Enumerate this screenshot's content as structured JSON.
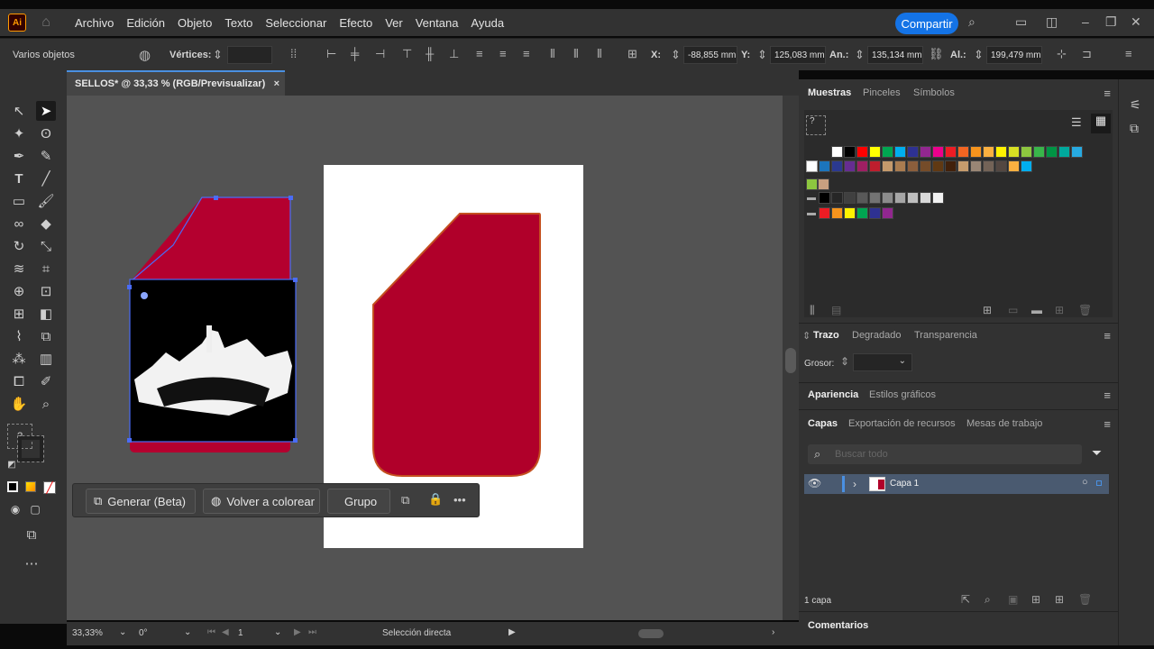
{
  "app": {
    "logo": "Ai",
    "home_icon": "home-icon"
  },
  "menu": [
    "Archivo",
    "Edición",
    "Objeto",
    "Texto",
    "Seleccionar",
    "Efecto",
    "Ver",
    "Ventana",
    "Ayuda"
  ],
  "share_label": "Compartir",
  "control": {
    "selection_label": "Varios objetos",
    "vertices_label": "Vértices:",
    "x_label": "X:",
    "x_value": "-88,855 mm",
    "y_label": "Y:",
    "y_value": "125,083 mm",
    "w_label": "An.:",
    "w_value": "135,134 mm",
    "h_label": "Al.:",
    "h_value": "199,479 mm"
  },
  "document_tab": {
    "title": "SELLOS* @ 33,33 % (RGB/Previsualizar)",
    "close": "×"
  },
  "floating_bar": {
    "generate": "Generar (Beta)",
    "recolor": "Volver a colorear",
    "group": "Grupo",
    "more": "•••"
  },
  "status": {
    "zoom": "33,33%",
    "angle": "0°",
    "artboard": "1",
    "tool": "Selección directa"
  },
  "swatches_panel": {
    "tabs": [
      "Muestras",
      "Pinceles",
      "Símbolos"
    ],
    "row1": [
      "#ffffff",
      "#000000",
      "#ff0000",
      "#ffff00",
      "#00a651",
      "#00aeef",
      "#2e3192",
      "#92278f",
      "#ec008c",
      "#ed1c24",
      "#f26522",
      "#f7941d",
      "#fbb040",
      "#fff200",
      "#d7df23",
      "#8dc63f",
      "#39b54a",
      "#009444",
      "#00a99d",
      "#27aae1"
    ],
    "row2": [
      "#29abe2",
      "#1c75bc",
      "#2b3990",
      "#662d91",
      "#9e1f63",
      "#be1e2d",
      "#c49a6c",
      "#a97c50",
      "#8b5e3c",
      "#754c29",
      "#603913",
      "#42210b",
      "#c69c6d",
      "#998675",
      "#736357",
      "#534741",
      "#fbb040",
      "#00aeef"
    ],
    "gray": [
      "#000000",
      "#262626",
      "#404040",
      "#595959",
      "#737373",
      "#8c8c8c",
      "#a6a6a6",
      "#bfbfbf",
      "#d9d9d9",
      "#f2f2f2"
    ],
    "bright": [
      "#ed1c24",
      "#f7941d",
      "#fff200",
      "#00a651",
      "#2e3192",
      "#92278f"
    ]
  },
  "stroke_panel": {
    "tabs": [
      "Trazo",
      "Degradado",
      "Transparencia"
    ],
    "weight_label": "Grosor:"
  },
  "appearance_panel": {
    "tabs": [
      "Apariencia",
      "Estilos gráficos"
    ]
  },
  "layers_panel": {
    "tabs": [
      "Capas",
      "Exportación de recursos",
      "Mesas de trabajo"
    ],
    "search_placeholder": "Buscar todo",
    "layer_name": "Capa 1",
    "count": "1 capa"
  },
  "comments_panel": {
    "title": "Comentarios"
  },
  "colors": {
    "accent": "#1473e6",
    "artwork_red": "#b0002a",
    "selection_blue": "#4a6cf7"
  }
}
